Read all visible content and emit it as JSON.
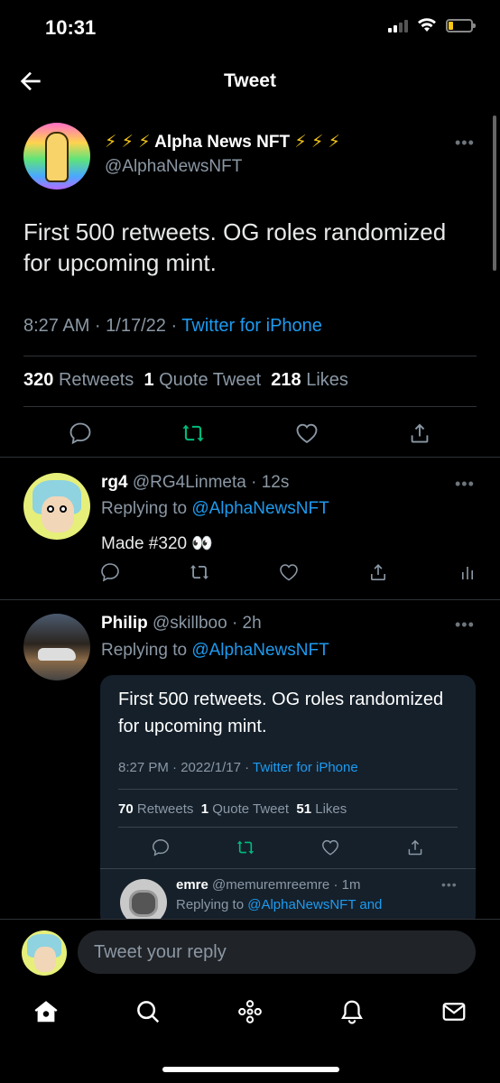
{
  "status": {
    "time": "10:31"
  },
  "nav": {
    "title": "Tweet"
  },
  "main_tweet": {
    "bolts_left": "⚡ ⚡ ⚡",
    "name": "Alpha News NFT",
    "bolts_right": "⚡ ⚡ ⚡",
    "handle": "@AlphaNewsNFT",
    "text": "First 500 retweets. OG roles randomized for upcoming mint.",
    "time": "8:27 AM · 1/17/22 · ",
    "source": "Twitter for iPhone",
    "retweets_count": "320",
    "retweets_label": "Retweets",
    "quotes_count": "1",
    "quotes_label": "Quote Tweet",
    "likes_count": "218",
    "likes_label": "Likes"
  },
  "replies": [
    {
      "name": "rg4",
      "handle_time": "@RG4Linmeta · 12s",
      "replying_prefix": "Replying to ",
      "replying_to": "@AlphaNewsNFT",
      "text": "Made #320 👀"
    },
    {
      "name": "Philip",
      "handle_time": "@skillboo · 2h",
      "replying_prefix": "Replying to ",
      "replying_to": "@AlphaNewsNFT"
    }
  ],
  "quote": {
    "text": "First 500 retweets. OG roles randomized for upcoming mint.",
    "time": "8:27 PM · 2022/1/17 · ",
    "source": "Twitter for iPhone",
    "retweets_count": "70",
    "retweets_label": "Retweets",
    "quotes_count": "1",
    "quotes_label": "Quote Tweet",
    "likes_count": "51",
    "likes_label": "Likes",
    "reply_name": "emre",
    "reply_handle_time": "@memuremreemre · 1m",
    "reply_replying_prefix": "Replying to ",
    "reply_replying_to": "@AlphaNewsNFT and"
  },
  "composer": {
    "placeholder": "Tweet your reply"
  },
  "colors": {
    "accent": "#1d9bf0",
    "retweet_green": "#00ba7c",
    "background": "#000000"
  },
  "icons": [
    "back-arrow-icon",
    "reply-icon",
    "retweet-icon",
    "like-icon",
    "share-icon",
    "analytics-icon",
    "more-icon",
    "home-icon",
    "search-icon",
    "spaces-icon",
    "notifications-icon",
    "messages-icon"
  ]
}
